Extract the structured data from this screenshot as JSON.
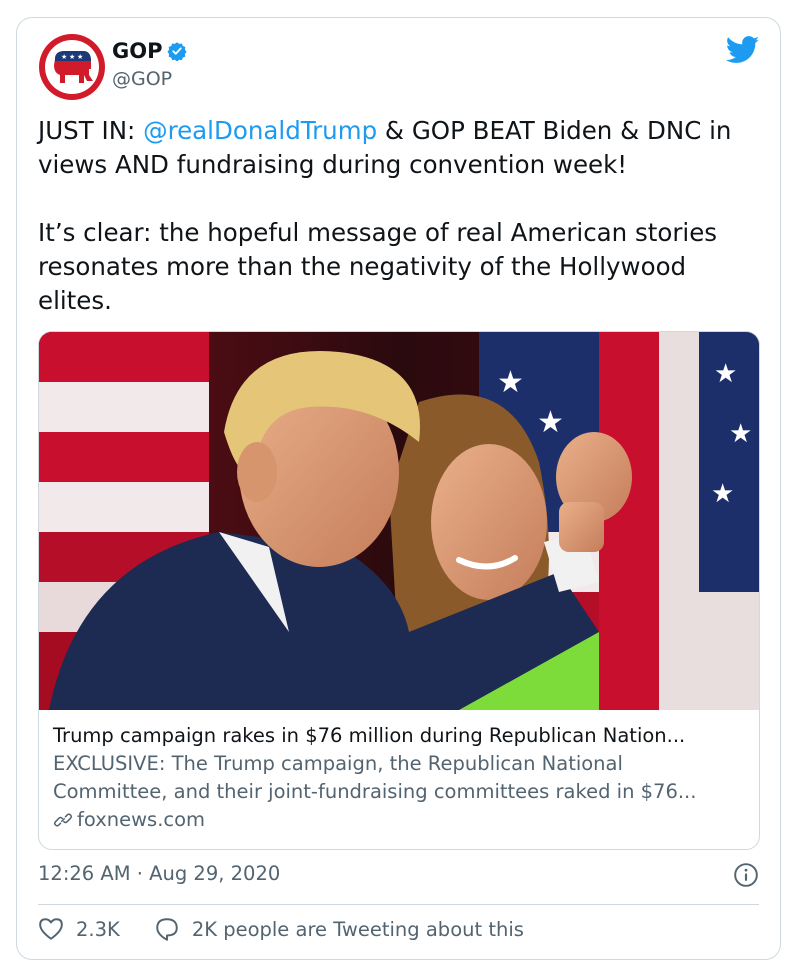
{
  "author": {
    "name": "GOP",
    "handle": "@GOP"
  },
  "tweet": {
    "line1_prefix": "JUST IN: ",
    "mention": "@realDonaldTrump",
    "line1_suffix": " & GOP BEAT Biden & DNC in views AND fundraising during convention week!",
    "paragraph2": "It’s clear: the hopeful message of real American stories resonates more than the negativity of the Hollywood elites."
  },
  "link_card": {
    "title": "Trump campaign rakes in $76 million during Republican Nation...",
    "description": "EXCLUSIVE: The Trump campaign, the Republican National Committee, and their joint-fundraising committees raked in $76...",
    "domain": "foxnews.com"
  },
  "meta": {
    "timestamp": "12:26 AM · Aug 29, 2020"
  },
  "actions": {
    "likes": "2.3K",
    "tweeting": "2K people are Tweeting about this"
  },
  "colors": {
    "accent": "#1d9bf0",
    "brand_red": "#d11a2a",
    "muted": "#536471"
  }
}
